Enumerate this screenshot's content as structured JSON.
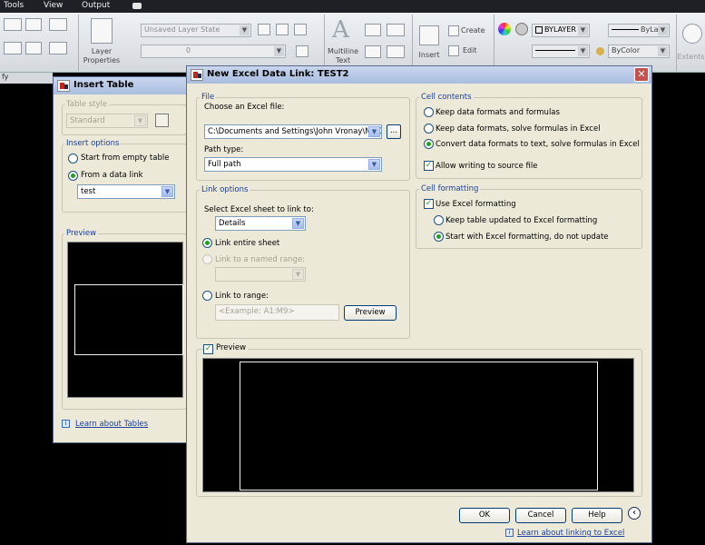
{
  "menubar": {
    "items": [
      "Tools",
      "View",
      "Output"
    ]
  },
  "ribbon": {
    "layer_state": "Unsaved Layer State",
    "layer_combo_value": "0",
    "layer_properties_label_1": "Layer",
    "layer_properties_label_2": "Properties",
    "multiline_label_1": "Multiline",
    "multiline_label_2": "Text",
    "insert_label": "Insert",
    "create_label": "Create",
    "edit_label": "Edit",
    "bylayer_label": "BYLAYER",
    "bylayer_short": "ByLa",
    "bycolor_label": "ByColor",
    "extents_label": "Extents",
    "left_strip_text": "fy"
  },
  "insert_table": {
    "title": "Insert Table",
    "table_style_label": "Table style",
    "table_style_value": "Standard",
    "insert_options_label": "Insert options",
    "start_empty": "Start from empty table",
    "from_data_link": "From a data link",
    "data_link_value": "test",
    "preview_label": "Preview",
    "learn_link": "Learn about Tables"
  },
  "excel_dialog": {
    "title": "New Excel Data Link: TEST2",
    "file_group": "File",
    "choose_file_label": "Choose an Excel file:",
    "file_value": "C:\\Documents and Settings\\John Vronay\\My Doc",
    "browse_label": "...",
    "path_type_label": "Path type:",
    "path_type_value": "Full path",
    "link_options_group": "Link options",
    "select_sheet_label": "Select Excel sheet to link to:",
    "sheet_value": "Details",
    "link_entire_sheet": "Link entire sheet",
    "link_named_range": "Link to a named range:",
    "link_to_range": "Link to range:",
    "range_placeholder": "<Example: A1:M9>",
    "preview_button": "Preview",
    "cell_contents_group": "Cell contents",
    "keep_formats_formulas": "Keep data formats and formulas",
    "keep_formats_solve": "Keep data formats, solve formulas in Excel",
    "convert_to_text": "Convert data formats to text, solve formulas in Excel",
    "allow_writing": "Allow writing to source file",
    "cell_formatting_group": "Cell formatting",
    "use_excel_formatting": "Use Excel formatting",
    "keep_updated": "Keep table updated to Excel formatting",
    "start_with_excel": "Start with Excel formatting, do not update",
    "preview_check_label": "Preview",
    "ok_button": "OK",
    "cancel_button": "Cancel",
    "help_button": "Help",
    "learn_link": "Learn about linking to Excel",
    "check_glyph": "✓",
    "close_glyph": "✕",
    "collapse_glyph": "‹"
  },
  "colors": {
    "dialog_bg": "#ece9d8",
    "title_blue": "#1a3f9e",
    "close_red": "#c75050"
  }
}
